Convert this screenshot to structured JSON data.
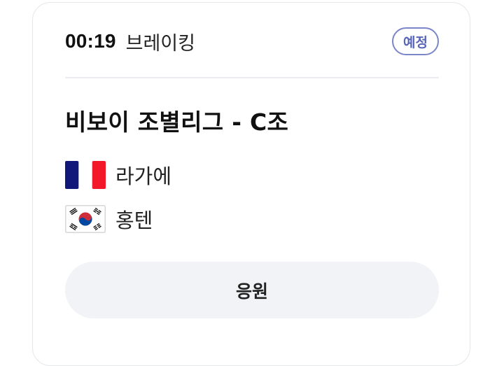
{
  "match": {
    "time": "00:19",
    "category": "브레이킹",
    "status_badge": "예정",
    "title": "비보이 조별리그 - C조",
    "teams": [
      {
        "name": "라가에",
        "flag": "france-flag-icon"
      },
      {
        "name": "홍텐",
        "flag": "south-korea-flag-icon"
      }
    ],
    "cheer_label": "응원"
  },
  "colors": {
    "badge_border": "#7b86c9",
    "badge_text": "#5866b9",
    "button_bg": "#f2f3f6",
    "divider": "#ebecef"
  }
}
